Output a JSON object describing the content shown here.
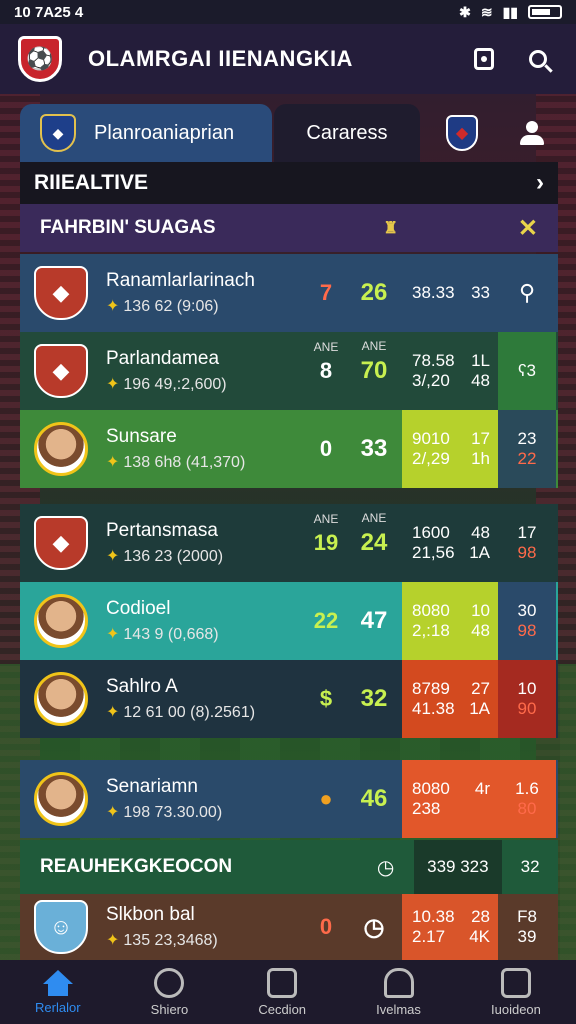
{
  "status": {
    "time": "10 7A25 4",
    "icons": "✱ ≋ ▮▮"
  },
  "app": {
    "title": "OLAMRGAI IIENANGKIA"
  },
  "tabs": {
    "active": "Planroaniaprian",
    "inactive": "Cararess"
  },
  "section": {
    "title": "RIIEALTIVE"
  },
  "group": {
    "title": "FAHRBIN' SUAGAS"
  },
  "rows": [
    {
      "name": "Ranamlarlarinach",
      "sub": "136 62 (9:06)",
      "s1": "7",
      "s2": "26",
      "st1": "38.33",
      "st2": "33",
      "bg": "#2a4a6c",
      "s1c": "#ff6a4a",
      "s2c": "#c8f050"
    },
    {
      "name": "Parlandamea",
      "sub": "196 49,:2,600)",
      "s1": "8",
      "s2": "70",
      "lbl": "ANE",
      "st1": "78.58",
      "st2": "1L",
      "st3": "3/,20",
      "st4": "48",
      "tail1": "ʕ3",
      "bg": "#224a3a",
      "s2c": "#c8f050",
      "tailbg": "#2e7a3a"
    },
    {
      "name": "Sunsare",
      "sub": "138 6h8 (41,370)",
      "s1": "0",
      "s2": "33",
      "st1": "9010",
      "st2": "17",
      "st3": "2/,29",
      "st4": "1h",
      "tail1": "23",
      "tail2": "22",
      "bg": "#3e8a3a",
      "statbg": "#b6d12c",
      "tailbg": "#2a4a5a"
    },
    {
      "name": "Pertansmasa",
      "sub": "136 23 (2000)",
      "s1": "19",
      "s2": "24",
      "lbl": "ANE",
      "st1": "1600",
      "st2": "48",
      "st3": "21,56",
      "st4": "1A",
      "tail1": "17",
      "tail2": "98",
      "bg": "#1e3b3a",
      "s1c": "#c8f050",
      "s2c": "#c8f050"
    },
    {
      "name": "Codioel",
      "sub": "143 9 (0,668)",
      "s1": "22",
      "s2": "47",
      "st1": "8080",
      "st2": "10",
      "st3": "2,:18",
      "st4": "48",
      "tail1": "30",
      "tail2": "98",
      "bg": "#2aa59a",
      "statbg": "#b6d12c",
      "tailbg": "#2a4a6a",
      "s1c": "#c8f050"
    },
    {
      "name": "Sahlro A",
      "sub": "12 61 00 (8).2561)",
      "s1": "$",
      "s2": "32",
      "st1": "8789",
      "st2": "27",
      "st3": "41.38",
      "st4": "1A",
      "tail1": "10",
      "tail2": "90",
      "bg": "#1f3340",
      "statbg": "#d34a1f",
      "tailbg": "#a52a20",
      "s1c": "#c8f050",
      "s2c": "#c8f050"
    },
    {
      "name": "Senariamn",
      "sub": "198 73.30.00)",
      "s1": "●",
      "s2": "46",
      "st1": "8080",
      "st2": "4r",
      "st3": "238",
      "st4": "",
      "tail1": "1.6",
      "tail2": "80",
      "bg": "#2a4a6a",
      "statbg": "#e2572a",
      "tailbg": "#e2572a",
      "s1c": "#f0a020",
      "s2c": "#c8f050"
    }
  ],
  "summary": {
    "title": "REAUHEKGKEOCON",
    "v1": "339 323",
    "v2": "32"
  },
  "last_row": {
    "name": "Slkbon bal",
    "sub": "135 23,3468)",
    "s1": "0",
    "st1": "10.38",
    "st2": "28",
    "st3": "2.17",
    "st4": "4K",
    "tail1": "F8",
    "tail2": "39"
  },
  "tabbar": [
    {
      "label": "Rerlalor",
      "icon": "home-icon"
    },
    {
      "label": "Shiero",
      "icon": "shield-icon"
    },
    {
      "label": "Cecdion",
      "icon": "calendar-icon"
    },
    {
      "label": "Ivelmas",
      "icon": "team-icon"
    },
    {
      "label": "Iuoideon",
      "icon": "profile-icon"
    }
  ]
}
